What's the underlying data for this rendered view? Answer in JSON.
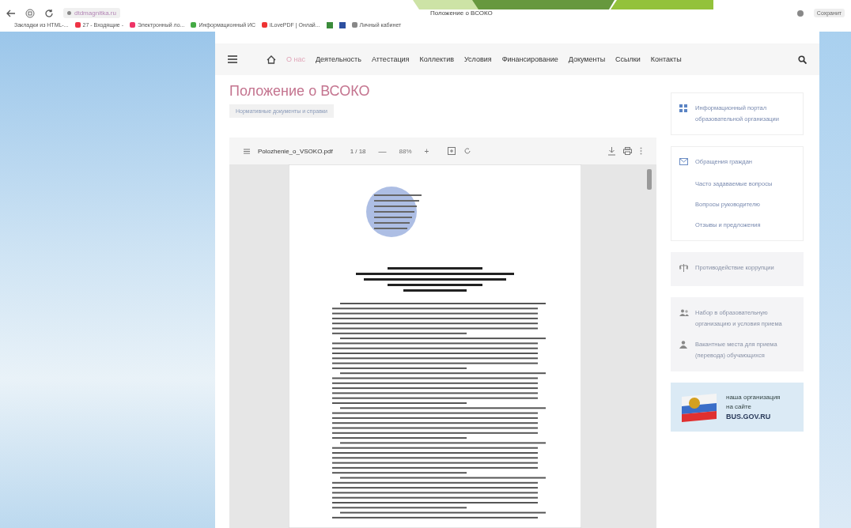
{
  "browser": {
    "url": "dtdmagnitka.ru",
    "tab_title": "Положение о ВСОКО",
    "right_button": "Сохранит",
    "bookmarks": [
      {
        "label": "Закладки из HTML-..."
      },
      {
        "label": "27 - Входящие -"
      },
      {
        "label": "Электронный ло..."
      },
      {
        "label": "Информационный ИС"
      },
      {
        "label": "iLovePDF | Онлай..."
      },
      {
        "label": "Личный кабинет"
      }
    ]
  },
  "nav": {
    "items": [
      {
        "label": "О нас",
        "selected": true
      },
      {
        "label": "Деятельность",
        "selected": false
      },
      {
        "label": "Аттестация",
        "selected": false
      },
      {
        "label": "Коллектив",
        "selected": false
      },
      {
        "label": "Условия",
        "selected": false
      },
      {
        "label": "Финансирование",
        "selected": false
      },
      {
        "label": "Документы",
        "selected": false
      },
      {
        "label": "Ссылки",
        "selected": false
      },
      {
        "label": "Контакты",
        "selected": false
      }
    ]
  },
  "page": {
    "title": "Положение о ВСОКО",
    "breadcrumb": "Нормативные документы и справки"
  },
  "pdf_viewer": {
    "file_name": "Polozhenie_o_VSOKO.pdf",
    "page": "1",
    "pages": "/ 18",
    "zoom_out": "—",
    "zoom": "88%",
    "zoom_in": "+"
  },
  "sidebar": [
    {
      "kind": "card",
      "items": [
        {
          "label": "Информационный портал образовательной организации"
        }
      ]
    },
    {
      "kind": "card",
      "items": [
        {
          "label": "Обращения граждан"
        },
        {
          "label": "Часто задаваемые вопросы"
        },
        {
          "label": "Вопросы руководителю"
        },
        {
          "label": "Отзывы и предложения"
        }
      ]
    },
    {
      "kind": "grey",
      "items": [
        {
          "label": "Противодействие коррупции"
        }
      ]
    },
    {
      "kind": "grey",
      "items": [
        {
          "label": "Набор в образовательную организацию и условия приема"
        },
        {
          "label": "Вакантные места для приема (перевода) обучающихся"
        }
      ]
    },
    {
      "kind": "banner",
      "line1": "наша организация",
      "line2": "на сайте",
      "line3": "BUS.GOV.RU"
    }
  ]
}
